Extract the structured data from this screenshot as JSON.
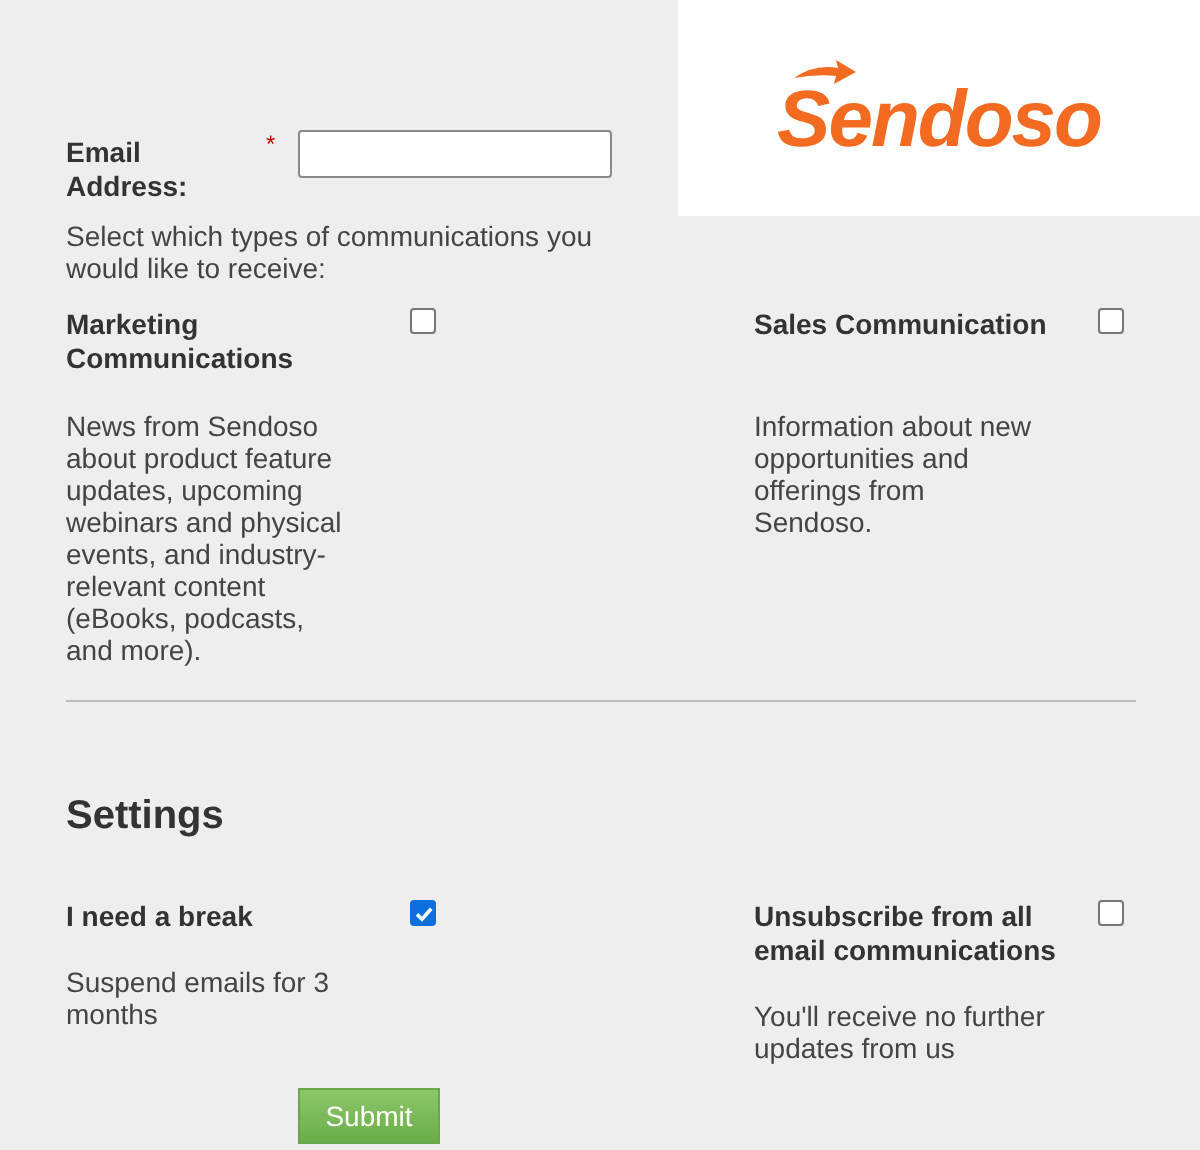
{
  "logo": {
    "text": "Sendoso"
  },
  "email": {
    "label": "Email Address:",
    "required_mark": "*"
  },
  "intro": "Select which types of communications you would like to receive:",
  "subscriptions": [
    {
      "label": "Marketing Communications",
      "checked": false,
      "description": "News from Sendoso about product feature updates, upcoming webinars and physical events, and industry-relevant content (eBooks, podcasts, and more)."
    },
    {
      "label": "Sales Communication",
      "checked": false,
      "description": "Information about new opportunities and offerings from Sendoso."
    }
  ],
  "settings": {
    "title": "Settings",
    "options": [
      {
        "label": "I need a break",
        "checked": true,
        "description": "Suspend emails for 3 months"
      },
      {
        "label": "Unsubscribe from all email communications",
        "checked": false,
        "description": "You'll receive no further updates from us"
      }
    ]
  },
  "submit": "Submit"
}
